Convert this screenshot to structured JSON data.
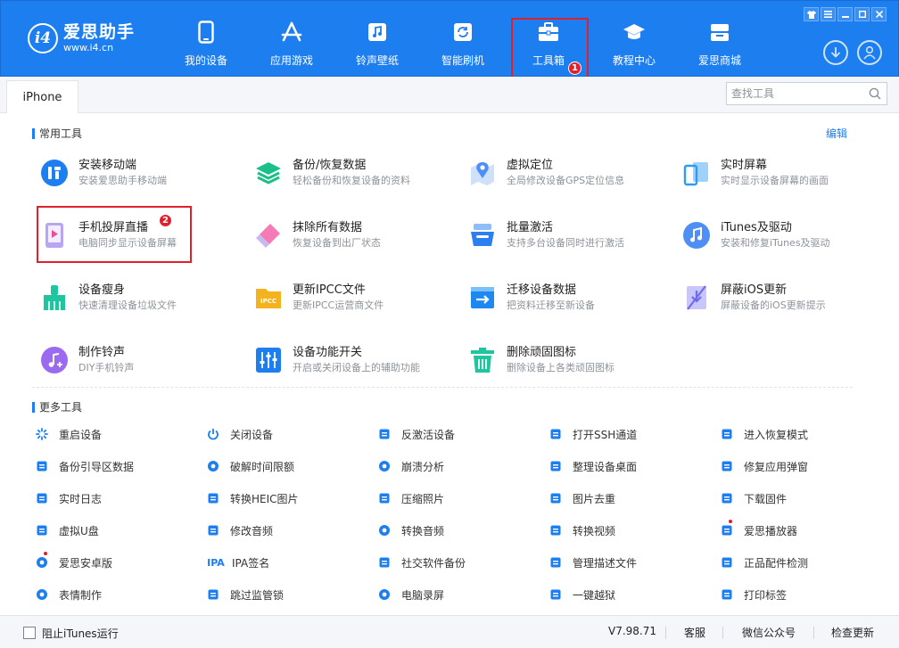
{
  "app": {
    "logo_badge": "i4",
    "logo_name": "爱思助手",
    "logo_url": "www.i4.cn"
  },
  "nav": {
    "items": [
      {
        "label": "我的设备",
        "icon": "phone-icon"
      },
      {
        "label": "应用游戏",
        "icon": "app-store-icon"
      },
      {
        "label": "铃声壁纸",
        "icon": "music-note-icon"
      },
      {
        "label": "智能刷机",
        "icon": "refresh-icon"
      },
      {
        "label": "工具箱",
        "icon": "toolbox-icon",
        "active": true
      },
      {
        "label": "教程中心",
        "icon": "graduation-cap-icon"
      },
      {
        "label": "爱思商城",
        "icon": "shop-icon"
      }
    ],
    "callout_1": "1"
  },
  "window": {
    "controls": [
      "shirt-icon",
      "list-icon",
      "minimize-icon",
      "maximize-icon",
      "close-icon"
    ]
  },
  "tabs": {
    "device_tab": "iPhone",
    "search_placeholder": "查找工具"
  },
  "common": {
    "title": "常用工具",
    "edit": "编辑",
    "callout_2": "2",
    "tools": [
      {
        "title": "安装移动端",
        "desc": "安装爱思助手移动端",
        "color": "#1d7ef0"
      },
      {
        "title": "备份/恢复数据",
        "desc": "轻松备份和恢复设备的资料",
        "color": "#1bbf8a"
      },
      {
        "title": "虚拟定位",
        "desc": "全局修改设备GPS定位信息",
        "color": "#4f8ff5"
      },
      {
        "title": "实时屏幕",
        "desc": "实时显示设备屏幕的画面",
        "color": "#2d9cf0"
      },
      {
        "title": "手机投屏直播",
        "desc": "电脑同步显示设备屏幕",
        "color": "#7a55e0"
      },
      {
        "title": "抹除所有数据",
        "desc": "恢复设备到出厂状态",
        "color": "#f05fa0"
      },
      {
        "title": "批量激活",
        "desc": "支持多台设备同时进行激活",
        "color": "#2b7ff0"
      },
      {
        "title": "iTunes及驱动",
        "desc": "安装和修复iTunes及驱动",
        "color": "#4f8ff5"
      },
      {
        "title": "设备瘦身",
        "desc": "快速清理设备垃圾文件",
        "color": "#1fc59e"
      },
      {
        "title": "更新IPCC文件",
        "desc": "更新IPCC运营商文件",
        "color": "#f4b31c"
      },
      {
        "title": "迁移设备数据",
        "desc": "把资料迁移至新设备",
        "color": "#1d88f0"
      },
      {
        "title": "屏蔽iOS更新",
        "desc": "屏蔽设备的iOS更新提示",
        "color": "#6f6af0"
      },
      {
        "title": "制作铃声",
        "desc": "DIY手机铃声",
        "color": "#9c6af0"
      },
      {
        "title": "设备功能开关",
        "desc": "开启或关闭设备上的辅助功能",
        "color": "#1d7ef0"
      },
      {
        "title": "删除顽固图标",
        "desc": "删除设备上各类顽固图标",
        "color": "#1fc59e"
      }
    ]
  },
  "more": {
    "title": "更多工具",
    "tools": [
      {
        "label": "重启设备",
        "icon": "spinner-icon"
      },
      {
        "label": "关闭设备",
        "icon": "power-icon"
      },
      {
        "label": "反激活设备",
        "icon": "deactivate-icon"
      },
      {
        "label": "打开SSH通道",
        "icon": "terminal-icon"
      },
      {
        "label": "进入恢复模式",
        "icon": "recovery-icon"
      },
      {
        "label": "备份引导区数据",
        "icon": "backup-icon"
      },
      {
        "label": "破解时间限额",
        "icon": "clock-icon"
      },
      {
        "label": "崩溃分析",
        "icon": "crash-chart-icon"
      },
      {
        "label": "整理设备桌面",
        "icon": "grid-icon"
      },
      {
        "label": "修复应用弹窗",
        "icon": "repair-icon"
      },
      {
        "label": "实时日志",
        "icon": "log-icon"
      },
      {
        "label": "转换HEIC图片",
        "icon": "convert-image-icon"
      },
      {
        "label": "压缩照片",
        "icon": "photo-icon"
      },
      {
        "label": "图片去重",
        "icon": "dedupe-image-icon"
      },
      {
        "label": "下载固件",
        "icon": "download-icon"
      },
      {
        "label": "虚拟U盘",
        "icon": "usb-icon"
      },
      {
        "label": "修改音频",
        "icon": "audio-file-icon"
      },
      {
        "label": "转换音频",
        "icon": "audio-convert-icon"
      },
      {
        "label": "转换视频",
        "icon": "video-convert-icon"
      },
      {
        "label": "爱思播放器",
        "icon": "player-icon",
        "dot": true
      },
      {
        "label": "爱思安卓版",
        "icon": "android-icon",
        "dot": true
      },
      {
        "label": "IPA签名",
        "icon": "ipa-icon",
        "icon_text": "IPA"
      },
      {
        "label": "社交软件备份",
        "icon": "social-backup-icon"
      },
      {
        "label": "管理描述文件",
        "icon": "profile-icon"
      },
      {
        "label": "正品配件检测",
        "icon": "accessory-icon"
      },
      {
        "label": "表情制作",
        "icon": "emoji-icon"
      },
      {
        "label": "跳过监管锁",
        "icon": "shield-lock-icon"
      },
      {
        "label": "电脑录屏",
        "icon": "record-icon"
      },
      {
        "label": "一键越狱",
        "icon": "unlock-icon"
      },
      {
        "label": "打印标签",
        "icon": "printer-icon"
      }
    ]
  },
  "footer": {
    "block_itunes": "阻止iTunes运行",
    "version": "V7.98.71",
    "service": "客服",
    "wechat": "微信公众号",
    "check_update": "检查更新"
  },
  "colors": {
    "brand": "#1d7ef0",
    "highlight": "#e0202a"
  }
}
